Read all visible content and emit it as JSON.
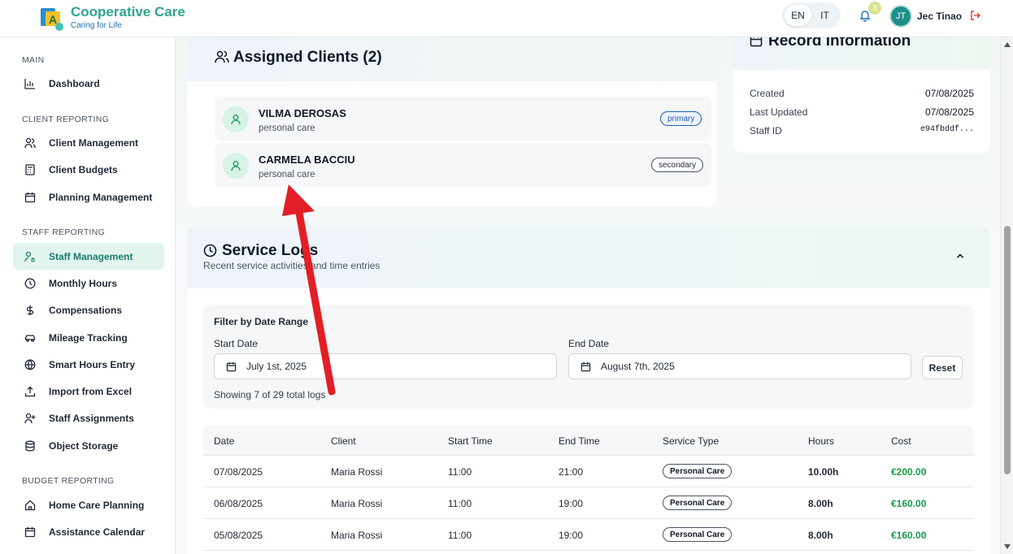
{
  "header": {
    "brand_title": "Cooperative Care",
    "brand_subtitle": "Caring for Life",
    "lang_en": "EN",
    "lang_it": "IT",
    "notification_count": "3",
    "avatar_initials": "JT",
    "user_name": "Jec Tinao"
  },
  "sidebar": {
    "sections": {
      "main": "MAIN",
      "client_reporting": "CLIENT REPORTING",
      "staff_reporting": "STAFF REPORTING",
      "budget_reporting": "BUDGET REPORTING"
    },
    "items": [
      {
        "label": "Dashboard",
        "icon": "bar-chart-icon"
      },
      {
        "label": "Client Management",
        "icon": "users-icon"
      },
      {
        "label": "Client Budgets",
        "icon": "calculator-icon"
      },
      {
        "label": "Planning Management",
        "icon": "calendar-icon"
      },
      {
        "label": "Staff Management",
        "icon": "user-cog-icon",
        "active": true
      },
      {
        "label": "Monthly Hours",
        "icon": "clock-icon"
      },
      {
        "label": "Compensations",
        "icon": "dollar-icon"
      },
      {
        "label": "Mileage Tracking",
        "icon": "car-icon"
      },
      {
        "label": "Smart Hours Entry",
        "icon": "globe-icon"
      },
      {
        "label": "Import from Excel",
        "icon": "upload-icon"
      },
      {
        "label": "Staff Assignments",
        "icon": "user-plus-icon"
      },
      {
        "label": "Object Storage",
        "icon": "database-icon"
      },
      {
        "label": "Home Care Planning",
        "icon": "home-icon"
      },
      {
        "label": "Assistance Calendar",
        "icon": "calendar-icon"
      }
    ]
  },
  "assigned_clients": {
    "title": "Assigned Clients (2)",
    "clients": [
      {
        "name": "VILMA DEROSAS",
        "type": "personal care",
        "badge": "primary"
      },
      {
        "name": "CARMELA BACCIU",
        "type": "personal care",
        "badge": "secondary"
      }
    ]
  },
  "record_info": {
    "title": "Record Information",
    "rows": [
      {
        "label": "Created",
        "value": "07/08/2025"
      },
      {
        "label": "Last Updated",
        "value": "07/08/2025"
      },
      {
        "label": "Staff ID",
        "value": "e94fbddf..."
      }
    ]
  },
  "service_logs": {
    "title": "Service Logs",
    "subtitle": "Recent service activities and time entries",
    "filter": {
      "title": "Filter by Date Range",
      "start_label": "Start Date",
      "start_value": "July 1st, 2025",
      "end_label": "End Date",
      "end_value": "August 7th, 2025",
      "reset_label": "Reset",
      "count_text": "Showing 7 of 29 total logs"
    },
    "columns": [
      "Date",
      "Client",
      "Start Time",
      "End Time",
      "Service Type",
      "Hours",
      "Cost"
    ],
    "rows": [
      {
        "date": "07/08/2025",
        "client": "Maria Rossi",
        "start": "11:00",
        "end": "21:00",
        "service": "Personal Care",
        "hours": "10.00h",
        "cost": "€200.00"
      },
      {
        "date": "06/08/2025",
        "client": "Maria Rossi",
        "start": "11:00",
        "end": "19:00",
        "service": "Personal Care",
        "hours": "8.00h",
        "cost": "€160.00"
      },
      {
        "date": "05/08/2025",
        "client": "Maria Rossi",
        "start": "11:00",
        "end": "19:00",
        "service": "Personal Care",
        "hours": "8.00h",
        "cost": "€160.00"
      }
    ]
  },
  "colors": {
    "brand": "#2fa58e",
    "accent_blue": "#1e6fb3",
    "active_nav_bg": "#e1f5ef",
    "cost_green": "#1a9a4a",
    "annotation_arrow": "#e41e26"
  }
}
